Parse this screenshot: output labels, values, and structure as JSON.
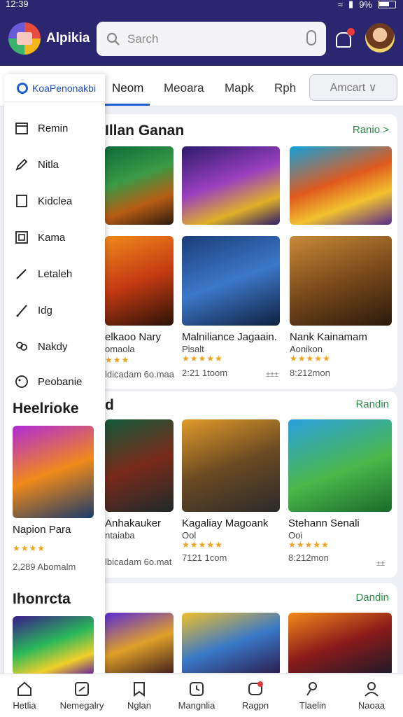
{
  "status": {
    "time": "12:39",
    "battery": "9%"
  },
  "header": {
    "app_name": "Alpikia",
    "search_placeholder": "Sarch"
  },
  "tabs": {
    "items": [
      "Neom",
      "Meoara",
      "Mapk",
      "Rph"
    ],
    "dropdown": "Amcart ∨"
  },
  "sidebar": {
    "header": "KoaPenonakbi",
    "items": [
      "Remin",
      "Nitla",
      "Kidclea",
      "Kama",
      "Letaleh",
      "Idg",
      "Nakdy",
      "Peobanie"
    ],
    "section1": "Heelrioke",
    "card": {
      "title": "Napion Para",
      "stars": "★★★★",
      "meta": "2,289 Abomalm"
    },
    "section2": "Ihonrcta"
  },
  "sections": [
    {
      "title": "Illan Ganan",
      "more": "Ranio >",
      "cards": [
        {
          "title": "elkaoo Nary",
          "sub": "omaola",
          "stars": "★★★",
          "meta": "ldicadam 6o.maa"
        },
        {
          "title": "Malniliance Jagaain.",
          "sub": "Pisalt",
          "stars": "★★★★★",
          "meta": "2:21 1toom"
        },
        {
          "title": "Nank Kainamam",
          "sub": "Aonikon",
          "stars": "★★★★★",
          "meta": "8:212mon"
        }
      ],
      "dl": "±±±"
    },
    {
      "title": "d",
      "more": "Randin",
      "cards": [
        {
          "title": "Anhakauker",
          "sub": "ntaiaba",
          "stars": "",
          "meta": "lbicadam 6o.mat"
        },
        {
          "title": "Kagaliay Magoank",
          "sub": "Ool",
          "stars": "★★★★★",
          "meta": "7121 1com"
        },
        {
          "title": "Stehann Senali",
          "sub": "Ooi",
          "stars": "★★★★★",
          "meta": "8:212mon"
        }
      ],
      "dl": "±±"
    },
    {
      "title": "",
      "more": "Dandin"
    }
  ],
  "bottom_nav": [
    "Hetlia",
    "Nemegalry",
    "Nglan",
    "Mangnlia",
    "Ragpn",
    "Tlaelin",
    "Naoaa"
  ]
}
